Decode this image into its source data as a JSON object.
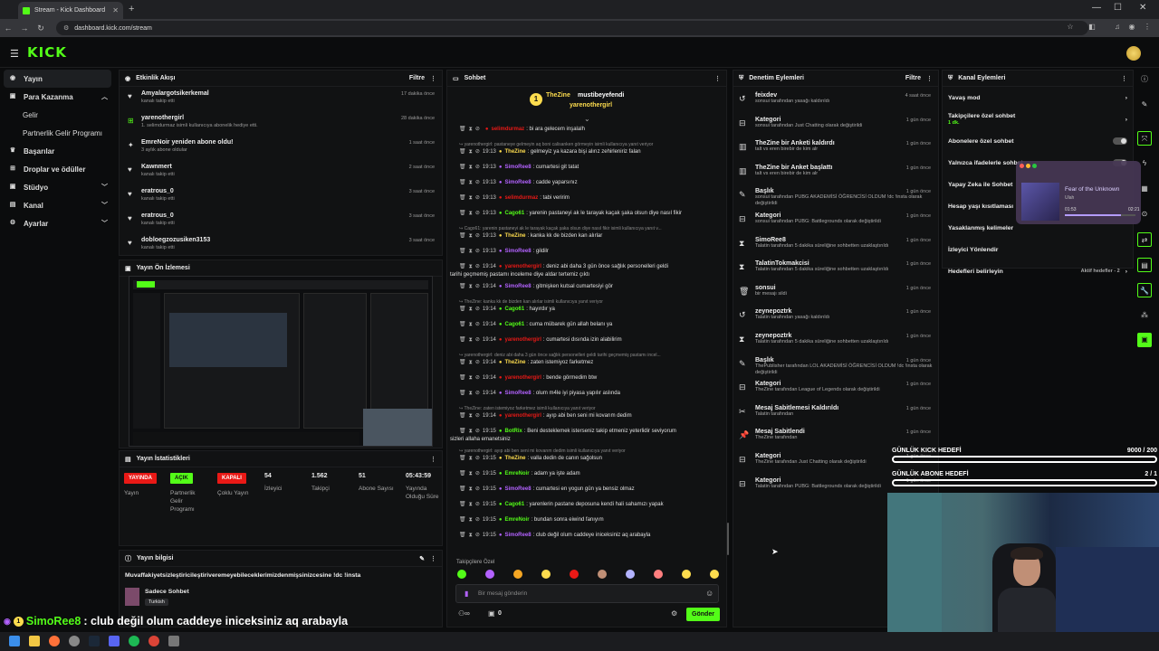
{
  "browser": {
    "tab_title": "Stream - Kick Dashboard",
    "url": "dashboard.kick.com/stream"
  },
  "sidebar": {
    "items": [
      {
        "label": "Yayın",
        "icon": "broadcast-icon",
        "active": true
      },
      {
        "label": "Para Kazanma",
        "icon": "money-icon",
        "chevron": "up"
      },
      {
        "label": "Gelir",
        "sub": true
      },
      {
        "label": "Partnerlik Gelir Programı",
        "sub": true
      },
      {
        "label": "Başarılar",
        "icon": "trophy-icon"
      },
      {
        "label": "Droplar ve ödüller",
        "icon": "gift-icon"
      },
      {
        "label": "Stüdyo",
        "icon": "studio-icon",
        "chevron": "down"
      },
      {
        "label": "Kanal",
        "icon": "channel-icon",
        "chevron": "down"
      },
      {
        "label": "Ayarlar",
        "icon": "settings-icon",
        "chevron": "down"
      }
    ]
  },
  "activity": {
    "title": "Etkinlik Akışı",
    "filter": "Filtre",
    "events": [
      {
        "icon": "heart-icon",
        "name": "Amyalargotsikerkemal",
        "sub": "kanalı takip etti",
        "time": "17 dakika önce"
      },
      {
        "icon": "gift-icon",
        "name": "yarenothergirl",
        "sub": "1. selimdurmaz isimli kullanıcıya abonelik hediye etti.",
        "time": "28 dakika önce"
      },
      {
        "icon": "star-icon",
        "name": "EmreNoir yeniden abone oldu!",
        "sub": "3 aylık abone oldular",
        "time": "1 saat önce"
      },
      {
        "icon": "heart-icon",
        "name": "Kawnmert",
        "sub": "kanalı takip etti",
        "time": "2 saat önce"
      },
      {
        "icon": "heart-icon",
        "name": "eratrous_0",
        "sub": "kanalı takip etti",
        "time": "3 saat önce"
      },
      {
        "icon": "heart-icon",
        "name": "eratrous_0",
        "sub": "kanalı takip etti",
        "time": "3 saat önce"
      },
      {
        "icon": "heart-icon",
        "name": "dobloegzozusiken3153",
        "sub": "kanalı takip etti",
        "time": "3 saat önce"
      }
    ]
  },
  "preview": {
    "title": "Yayın Ön İzlemesi"
  },
  "stats": {
    "title": "Yayın İstatistikleri",
    "items": [
      {
        "badge": "YAYINDA",
        "badge_color": "#e91916",
        "label": "Yayın"
      },
      {
        "badge": "AÇIK",
        "badge_color": "#53fc18",
        "label": "Partnerlik Gelir Programı"
      },
      {
        "badge": "KAPALI",
        "badge_color": "#e91916",
        "label": "Çoklu Yayın"
      },
      {
        "value": "54",
        "label": "İzleyici"
      },
      {
        "value": "1.562",
        "label": "Takipçi"
      },
      {
        "value": "51",
        "label": "Abone Sayısı"
      },
      {
        "value": "05:43:59",
        "label": "Yayında Olduğu Süre"
      }
    ]
  },
  "stream_info": {
    "title": "Yayın bilgisi",
    "stream_title": "Muvaffakiyetsizleştiricileştiriveremeyebileceklerimizdenmişsinizcesine !dc !insta",
    "category": "Sadece Sohbet",
    "tag": "Turkish"
  },
  "chat": {
    "title": "Sohbet",
    "pinned": [
      {
        "name": "TheZine",
        "color": "#fddc4e",
        "count": "1"
      },
      {
        "name": "mustibeyefendi",
        "color": "#ffffff",
        "count": "1"
      },
      {
        "name": "yarenothergirl",
        "color": "#fddc4e",
        "count": "1"
      }
    ],
    "messages": [
      {
        "type": "msg",
        "time": "",
        "user": "selimdurmaz",
        "color": "#e91916",
        "text": "bi ara gelecem inşalalh"
      },
      {
        "type": "reply",
        "text": "yarenothergirl: pastaneye gelmeyin aq boni calisanken görmeyin isimli kullanıcıya yanıt veriyor"
      },
      {
        "type": "msg",
        "time": "19:13",
        "user": "TheZine",
        "color": "#fddc4e",
        "text": "gelmeyiz ya kazara bişi alırız zehirleniriz falan"
      },
      {
        "type": "msg",
        "time": "19:13",
        "user": "SimoRee8",
        "color": "#b362ff",
        "text": "cumartesi git tatat"
      },
      {
        "type": "msg",
        "time": "19:13",
        "user": "SimoRee8",
        "color": "#b362ff",
        "text": "cadde yaparsınız"
      },
      {
        "type": "msg",
        "time": "19:13",
        "user": "selimdurmaz",
        "color": "#e91916",
        "text": "tabi veririm"
      },
      {
        "type": "msg",
        "time": "19:13",
        "user": "Cago61",
        "color": "#53fc18",
        "text": "yarenin pastaneyi ak le tarayak kaçak şaka olsun diye nasıl fikir"
      },
      {
        "type": "reply",
        "text": "Cago61: yarenin pastaneyi ak le tarayak kaçak şaka olsun diye nasıl fikir isimli kullanıcıya yanıt v..."
      },
      {
        "type": "msg",
        "time": "19:13",
        "user": "TheZine",
        "color": "#fddc4e",
        "text": "kanka kk de bizden kan alırlar"
      },
      {
        "type": "msg",
        "time": "19:13",
        "user": "SimoRee8",
        "color": "#b362ff",
        "text": "gildilr"
      },
      {
        "type": "msg2",
        "time": "19:14",
        "user": "yarenothergirl",
        "color": "#e91916",
        "text": "deniz abi daha 3 gün önce sağlık personelleri geldi",
        "text2": "tarihi geçmemiş pastamı inceleme diye aldar tertemiz çıktı"
      },
      {
        "type": "msg",
        "time": "19:14",
        "user": "SimoRee8",
        "color": "#b362ff",
        "text": "gitmişken kutsal cumartesiyi gör"
      },
      {
        "type": "reply",
        "text": "TheZine: kanka kk de bizden kan alırlar isimli kullanıcıya yanıt veriyor"
      },
      {
        "type": "msg",
        "time": "19:14",
        "user": "Cago61",
        "color": "#53fc18",
        "text": "hayırdır ya"
      },
      {
        "type": "msg",
        "time": "19:14",
        "user": "Cago61",
        "color": "#53fc18",
        "text": "cuma mübarek gün allah belanı ya"
      },
      {
        "type": "msg",
        "time": "19:14",
        "user": "yarenothergirl",
        "color": "#e91916",
        "text": "cumartesi dısında izin alabilirim"
      },
      {
        "type": "reply",
        "text": "yarenothergirl: deniz abi daha 3 gün önce sağlık personelleri geldi tarihi geçmemiş pastamı incel..."
      },
      {
        "type": "msg",
        "time": "19:14",
        "user": "TheZine",
        "color": "#fddc4e",
        "text": "zaten istemiyoz farketmez"
      },
      {
        "type": "msg",
        "time": "19:14",
        "user": "yarenothergirl",
        "color": "#e91916",
        "text": "bende görmedim btw"
      },
      {
        "type": "msg",
        "time": "19:14",
        "user": "SimoRee8",
        "color": "#b362ff",
        "text": "olum m4le iyi piyasa yapılır aslında"
      },
      {
        "type": "reply",
        "text": "TheZine: zaten istemiyoz farketmez isimli kullanıcıya yanıt veriyor"
      },
      {
        "type": "msg",
        "time": "19:14",
        "user": "yarenothergirl",
        "color": "#e91916",
        "text": "ayıp abi ben seni mi kovarım dedim"
      },
      {
        "type": "msg2",
        "time": "19:15",
        "user": "BotRix",
        "color": "#53fc18",
        "text": "Beni desteklemek isterseniz takip etmeniz yeterlidir seviyorum",
        "text2": "sizleri allaha emanetsiniz"
      },
      {
        "type": "reply",
        "text": "yarenothergirl: ayıp abi ben seni mi kovarım dedim isimli kullanıcıya yanıt veriyor"
      },
      {
        "type": "msg",
        "time": "19:15",
        "user": "TheZine",
        "color": "#fddc4e",
        "text": "valla dedin de canın sağolsun"
      },
      {
        "type": "msg",
        "time": "19:15",
        "user": "EmreNoir",
        "color": "#53fc18",
        "text": "adam ya işte adam"
      },
      {
        "type": "msg",
        "time": "19:15",
        "user": "SimoRee8",
        "color": "#b362ff",
        "text": "cumartesi en yogun gün ya bensiz olmaz"
      },
      {
        "type": "msg",
        "time": "19:15",
        "user": "Cago61",
        "color": "#53fc18",
        "text": "yarenlerin pastane deposuna kendi hali sahamızı yapak"
      },
      {
        "type": "msg",
        "time": "19:15",
        "user": "EmreNoir",
        "color": "#53fc18",
        "text": "bundan sonra eiwind fanıyım"
      },
      {
        "type": "msg",
        "time": "19:15",
        "user": "SimoRee8",
        "color": "#b362ff",
        "text": "club değil olum caddeye iniceksiniz aq arabayla"
      }
    ],
    "emote_label": "Takipçilere Özel",
    "input_placeholder": "Bir mesaj gönderin",
    "counter": "0",
    "send_label": "Gönder"
  },
  "modlog": {
    "title": "Denetim Eylemleri",
    "filter": "Filtre",
    "items": [
      {
        "icon": "unban-icon",
        "title": "feixdev",
        "desc": "sonsui tarafından yasağı kaldırıldı",
        "time": "4 saat önce"
      },
      {
        "icon": "category-icon",
        "title": "Kategori",
        "desc": "sonsui tarafından Just Chatting olarak değiştirildi",
        "time": "1 gün önce"
      },
      {
        "icon": "poll-icon",
        "title": "TheZine bir Anketi kaldırdı",
        "desc": "talt vs eren birebir de kim alr",
        "time": "1 gün önce"
      },
      {
        "icon": "poll-icon",
        "title": "TheZine bir Anket başlattı",
        "desc": "talt vs eren birebir de kim alr",
        "time": "1 gün önce"
      },
      {
        "icon": "title-icon",
        "title": "Başlık",
        "desc": "sonsui tarafından PUBG AKADEMİSİ ÖĞRENCİSİ OLDUM !dc !insta olarak değiştirildi",
        "time": "1 gün önce"
      },
      {
        "icon": "category-icon",
        "title": "Kategori",
        "desc": "sonsui tarafından PUBG: Battlegrounds olarak değiştirildi",
        "time": "1 gün önce"
      },
      {
        "icon": "timeout-icon",
        "title": "SimoRee8",
        "desc": "Talatin tarafından 5 dakika süreliğine sohbetten uzaklaştırıldı",
        "time": "1 gün önce"
      },
      {
        "icon": "timeout-icon",
        "title": "TalatinTokmakcisi",
        "desc": "Talatin tarafından 5 dakika süreliğine sohbetten uzaklaştırıldı",
        "time": "1 gün önce"
      },
      {
        "icon": "trash-icon",
        "title": "sonsui",
        "desc": "bir mesajı sildi",
        "time": "1 gün önce"
      },
      {
        "icon": "unban-icon",
        "title": "zeynepoztrk",
        "desc": "Talatin tarafından yasağı kaldırıldı",
        "time": "1 gün önce"
      },
      {
        "icon": "timeout-icon",
        "title": "zeynepoztrk",
        "desc": "Talatin tarafından 5 dakika süreliğine sohbetten uzaklaştırıldı",
        "time": "1 gün önce"
      },
      {
        "icon": "title-icon",
        "title": "Başlık",
        "desc": "ThePublisher tarafından LOL AKADEMİSİ ÖĞRENCİSİ OLDUM !dc !insta olarak değiştirildi",
        "time": "1 gün önce"
      },
      {
        "icon": "category-icon",
        "title": "Kategori",
        "desc": "TheZine tarafından League of Legends olarak değiştirildi",
        "time": "1 gün önce"
      },
      {
        "icon": "unpin-icon",
        "title": "Mesaj Sabitlemesi Kaldırıldı",
        "desc": "Talatin tarafından",
        "time": "1 gün önce"
      },
      {
        "icon": "pin-icon",
        "title": "Mesaj Sabitlendi",
        "desc": "TheZine tarafından",
        "time": "1 gün önce"
      },
      {
        "icon": "category-icon",
        "title": "Kategori",
        "desc": "TheZine tarafından Just Chatting olarak değiştirildi",
        "time": "1 gün önce"
      },
      {
        "icon": "category-icon",
        "title": "Kategori",
        "desc": "Talatin tarafından PUBG: Battlegrounds olarak değiştirildi",
        "time": "1 gün önce"
      }
    ]
  },
  "channel_actions": {
    "title": "Kanal Eylemleri",
    "items": [
      {
        "label": "Yavaş mod",
        "control": "arrow"
      },
      {
        "label": "Takipçilere özel sohbet",
        "sub": "1 dk.",
        "control": "arrow"
      },
      {
        "label": "Abonelere özel sohbet",
        "control": "toggle"
      },
      {
        "label": "Yalnızca ifadelerle sohbet",
        "control": "toggle"
      },
      {
        "label": "Yapay Zeka ile Sohbet",
        "control": "none"
      },
      {
        "label": "Hesap yaşı kısıtlaması",
        "control": "none"
      },
      {
        "label": "Yasaklanmış kelimeler",
        "control": "none"
      },
      {
        "label": "İzleyici Yönlendir",
        "control": "none"
      },
      {
        "label": "Hedefleri belirleyin",
        "extra": "Aktif hedefler - 2",
        "control": "arrow"
      }
    ]
  },
  "music": {
    "song": "Fear of the Unknown",
    "artist": "Ulah",
    "elapsed": "01:53",
    "total": "02:21",
    "progress": 0.8
  },
  "goals": [
    {
      "label": "GÜNLÜK KICK HEDEFİ",
      "value": "9000 / 200"
    },
    {
      "label": "GÜNLÜK ABONE HEDEFİ",
      "value": "2 / 1"
    }
  ],
  "bottom_chat": {
    "user": "SimoRee8",
    "user_color": "#53fc18",
    "text": ": club değil olum caddeye iniceksiniz aq arabayla"
  }
}
